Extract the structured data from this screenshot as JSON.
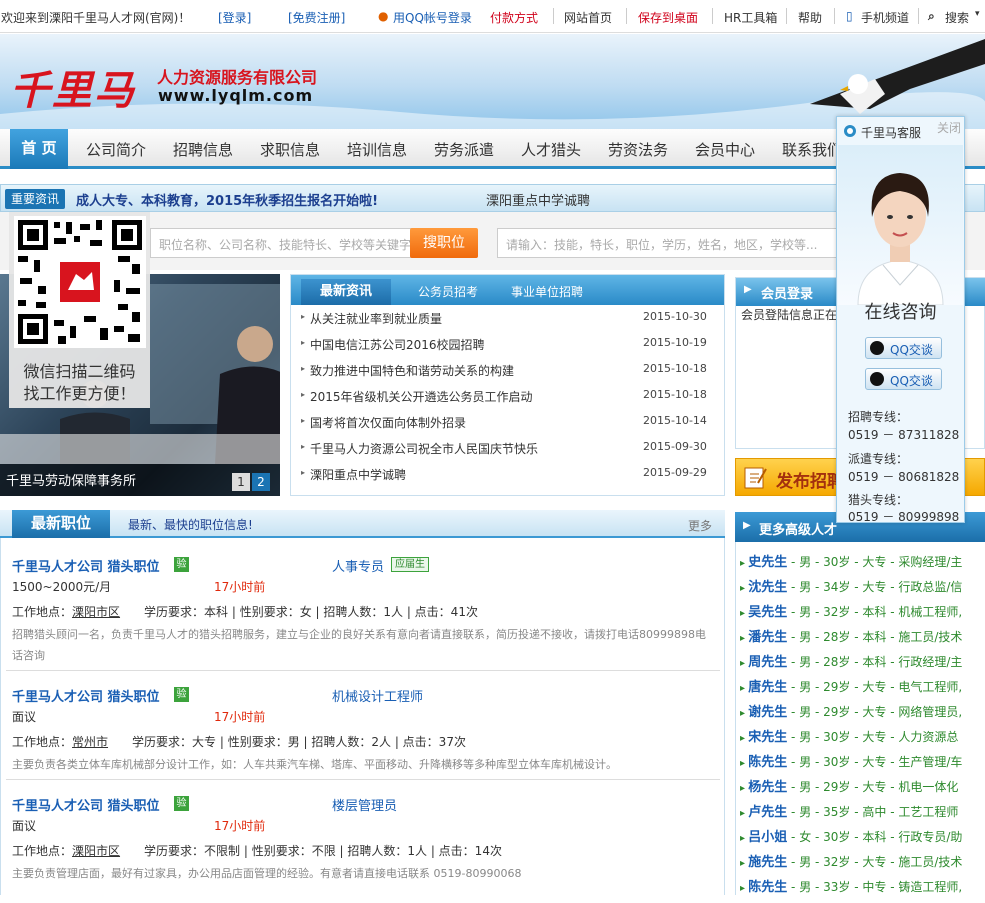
{
  "topbar": {
    "welcome": "欢迎来到溧阳千里马人才网(官网)！",
    "login": "[登录]",
    "register": "[免费注册]",
    "qq_login": "用QQ帐号登录",
    "payment": "付款方式",
    "home": "网站首页",
    "save_desktop": "保存到桌面",
    "hr_tools": "HR工具箱",
    "help": "帮助",
    "mobile": "手机频道",
    "search": "搜索"
  },
  "header": {
    "logo_text": "千里马",
    "company": "人力资源服务有限公司",
    "url": "www.lyqlm.com"
  },
  "nav": {
    "items": [
      "首 页",
      "公司简介",
      "招聘信息",
      "求职信息",
      "培训信息",
      "劳务派遣",
      "人才猎头",
      "劳资法务",
      "会员中心",
      "联系我们"
    ]
  },
  "ticker": {
    "tag": "重要资讯",
    "main": "成人大专、本科教育，2015年秋季招生报名开始啦!",
    "sub": "溧阳重点中学诚聘"
  },
  "search": {
    "job_placeholder": "职位名称、公司名称、技能特长、学校等关键字...",
    "job_button": "搜职位",
    "resume_placeholder": "请输入：技能，特长，职位，学历，姓名，地区，学校等..."
  },
  "qr": {
    "line1": "微信扫描二维码",
    "line2": "找工作更方便！"
  },
  "slider": {
    "caption": "千里马劳动保障事务所",
    "pages": [
      "1",
      "2"
    ]
  },
  "news": {
    "tabs": [
      "最新资讯",
      "公务员招考",
      "事业单位招聘"
    ],
    "items": [
      {
        "title": "从关注就业率到就业质量",
        "date": "2015-10-30"
      },
      {
        "title": "中国电信江苏公司2016校园招聘",
        "date": "2015-10-19"
      },
      {
        "title": "致力推进中国特色和谐劳动关系的构建",
        "date": "2015-10-18"
      },
      {
        "title": "2015年省级机关公开遴选公务员工作启动",
        "date": "2015-10-18"
      },
      {
        "title": "国考将首次仅面向体制外招录",
        "date": "2015-10-14"
      },
      {
        "title": "千里马人力资源公司祝全市人民国庆节快乐",
        "date": "2015-09-30"
      },
      {
        "title": "溧阳重点中学诚聘",
        "date": "2015-09-29"
      }
    ]
  },
  "member": {
    "title": "会员登录",
    "body": "会员登陆信息正在"
  },
  "post_job": {
    "label": "发布招聘"
  },
  "jobs": {
    "title": "最新职位",
    "subtitle": "最新、最快的职位信息!",
    "more": "更多",
    "yan": "验",
    "items": [
      {
        "company": "千里马人才公司 猎头职位",
        "position": "人事专员",
        "badge": "应届生",
        "salary": "1500~2000元/月",
        "time": "17小时前",
        "location_label": "工作地点：",
        "location": "溧阳市区",
        "details": "学历要求：本科 | 性别要求：女 | 招聘人数：1人 | 点击：41次",
        "desc": "招聘猎头顾问一名，负责千里马人才的猎头招聘服务，建立与企业的良好关系有意向者请直接联系，简历投递不接收，请拨打电话80999898电话咨询"
      },
      {
        "company": "千里马人才公司 猎头职位",
        "position": "机械设计工程师",
        "badge": "",
        "salary": "面议",
        "time": "17小时前",
        "location_label": "工作地点：",
        "location": "常州市",
        "details": "学历要求：大专 | 性别要求：男 | 招聘人数：2人 | 点击：37次",
        "desc": "主要负责各类立体车库机械部分设计工作，如：人车共乘汽车梯、塔库、平面移动、升降横移等多种库型立体车库机械设计。"
      },
      {
        "company": "千里马人才公司 猎头职位",
        "position": "楼层管理员",
        "badge": "",
        "salary": "面议",
        "time": "17小时前",
        "location_label": "工作地点：",
        "location": "溧阳市区",
        "details": "学历要求：不限制 | 性别要求：不限 | 招聘人数：1人 | 点击：14次",
        "desc": "主要负责管理店面，最好有过家具，办公用品店面管理的经验。有意者请直接电话联系 0519-80990068"
      }
    ]
  },
  "talent": {
    "title": "更多高级人才",
    "items": [
      {
        "name": "史先生",
        "rest": "- 男 - 30岁 - 大专 - 采购经理/主"
      },
      {
        "name": "沈先生",
        "rest": "- 男 - 34岁 - 大专 - 行政总监/信"
      },
      {
        "name": "吴先生",
        "rest": "- 男 - 32岁 - 本科 - 机械工程师,"
      },
      {
        "name": "潘先生",
        "rest": "- 男 - 28岁 - 本科 - 施工员/技术"
      },
      {
        "name": "周先生",
        "rest": "- 男 - 28岁 - 本科 - 行政经理/主"
      },
      {
        "name": "唐先生",
        "rest": "- 男 - 29岁 - 大专 - 电气工程师,"
      },
      {
        "name": "谢先生",
        "rest": "- 男 - 29岁 - 大专 - 网络管理员,"
      },
      {
        "name": "宋先生",
        "rest": "- 男 - 30岁 - 大专 - 人力资源总"
      },
      {
        "name": "陈先生",
        "rest": "- 男 - 30岁 - 大专 - 生产管理/车"
      },
      {
        "name": "杨先生",
        "rest": "- 男 - 29岁 - 大专 - 机电一体化"
      },
      {
        "name": "卢先生",
        "rest": "- 男 - 35岁 - 高中 - 工艺工程师"
      },
      {
        "name": "吕小姐",
        "rest": "- 女 - 30岁 - 本科 - 行政专员/助"
      },
      {
        "name": "施先生",
        "rest": "- 男 - 32岁 - 大专 - 施工员/技术"
      },
      {
        "name": "陈先生",
        "rest": "- 男 - 33岁 - 中专 - 铸造工程师,"
      }
    ]
  },
  "service": {
    "title": "千里马客服",
    "close": "关闭",
    "online": "在线咨询",
    "qq1": "QQ交谈",
    "qq2": "QQ交谈",
    "lines": [
      {
        "label": "招聘专线：",
        "phone": "0519 － 87311828"
      },
      {
        "label": "派遣专线：",
        "phone": "0519 － 80681828"
      },
      {
        "label": "猎头专线：",
        "phone": "0519 － 80999898"
      }
    ]
  },
  "colors": {
    "brand_red": "#d8141e",
    "brand_blue": "#2a8cc6",
    "link_blue": "#1a5fb4",
    "green": "#2e8a2e"
  }
}
